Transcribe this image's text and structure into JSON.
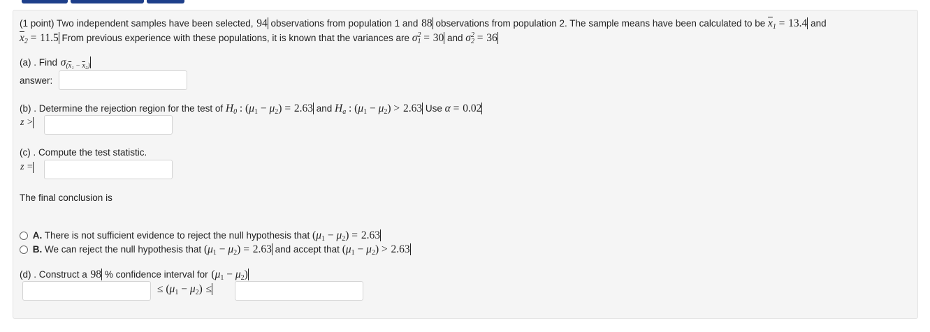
{
  "problem": {
    "intro_a": "(1 point) Two independent samples have been selected,",
    "n1": "94",
    "intro_b": "observations from population 1 and",
    "n2": "88",
    "intro_c": "observations from population 2. The sample means have been calculated to be",
    "xbar1_value": "13.4",
    "and": "and",
    "xbar2_value": "11.5",
    "intro_d": "From previous experience with these populations, it is known that the variances are",
    "var1": "30",
    "var2": "36"
  },
  "part_a": {
    "label": "(a) . Find",
    "answer_label": "answer:",
    "answer_value": ""
  },
  "part_b": {
    "label": "(b) . Determine the rejection region for the test of",
    "h0_value": "2.63",
    "and": "and",
    "ha_value": "2.63",
    "use": "Use",
    "alpha": "0.02",
    "z_label": "z >",
    "answer_value": ""
  },
  "part_c": {
    "label": "(c) . Compute the test statistic.",
    "z_label": "z =",
    "answer_value": ""
  },
  "conclusion": {
    "label": "The final conclusion is",
    "option_a_letter": "A.",
    "option_a_text": "There is not sufficient evidence to reject the null hypothesis that",
    "option_a_value": "2.63",
    "option_b_letter": "B.",
    "option_b_text": "We can reject the null hypothesis that",
    "option_b_value": "2.63",
    "option_b_and": "and accept that",
    "option_b_value2": "2.63"
  },
  "part_d": {
    "label_a": "(d) . Construct a",
    "confidence": "98",
    "label_b": "% confidence interval for",
    "lower_value": "",
    "upper_value": ""
  }
}
